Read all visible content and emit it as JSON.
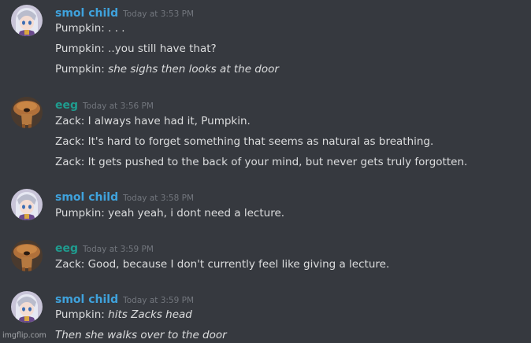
{
  "colors": {
    "background": "#36393f",
    "text": "#dcddde",
    "timestamp": "#72767d",
    "smol_child": "#3fa2dc",
    "eeg": "#1f9c8f"
  },
  "messages": [
    {
      "author": "smol child",
      "avatar": "anime-girl-avatar-icon",
      "timestamp": "Today at 3:53 PM",
      "lines": [
        {
          "prefix": "Pumpkin: . . .",
          "italic": ""
        },
        {
          "prefix": "Pumpkin: ..you still have that?",
          "italic": ""
        },
        {
          "prefix": "Pumpkin: ",
          "italic": "she sighs then looks at the door"
        }
      ]
    },
    {
      "author": "eeg",
      "avatar": "mushroom-creature-avatar-icon",
      "timestamp": "Today at 3:56 PM",
      "lines": [
        {
          "prefix": "Zack: I always have had it, Pumpkin.",
          "italic": ""
        },
        {
          "prefix": "Zack: It's hard to forget something that seems as natural as breathing.",
          "italic": ""
        },
        {
          "prefix": "Zack: It gets pushed to the back of your mind, but never gets truly forgotten.",
          "italic": ""
        }
      ]
    },
    {
      "author": "smol child",
      "avatar": "anime-girl-avatar-icon",
      "timestamp": "Today at 3:58 PM",
      "lines": [
        {
          "prefix": "Pumpkin: yeah yeah, i dont need a lecture.",
          "italic": ""
        }
      ]
    },
    {
      "author": "eeg",
      "avatar": "mushroom-creature-avatar-icon",
      "timestamp": "Today at 3:59 PM",
      "lines": [
        {
          "prefix": "Zack: Good, because I don't currently feel like giving a lecture.",
          "italic": ""
        }
      ]
    },
    {
      "author": "smol child",
      "avatar": "anime-girl-avatar-icon",
      "timestamp": "Today at 3:59 PM",
      "lines": [
        {
          "prefix": "Pumpkin: ",
          "italic": "hits Zacks head"
        },
        {
          "prefix": "",
          "italic": "Then she walks over to the door"
        }
      ]
    }
  ],
  "watermark": "imgflip.com"
}
